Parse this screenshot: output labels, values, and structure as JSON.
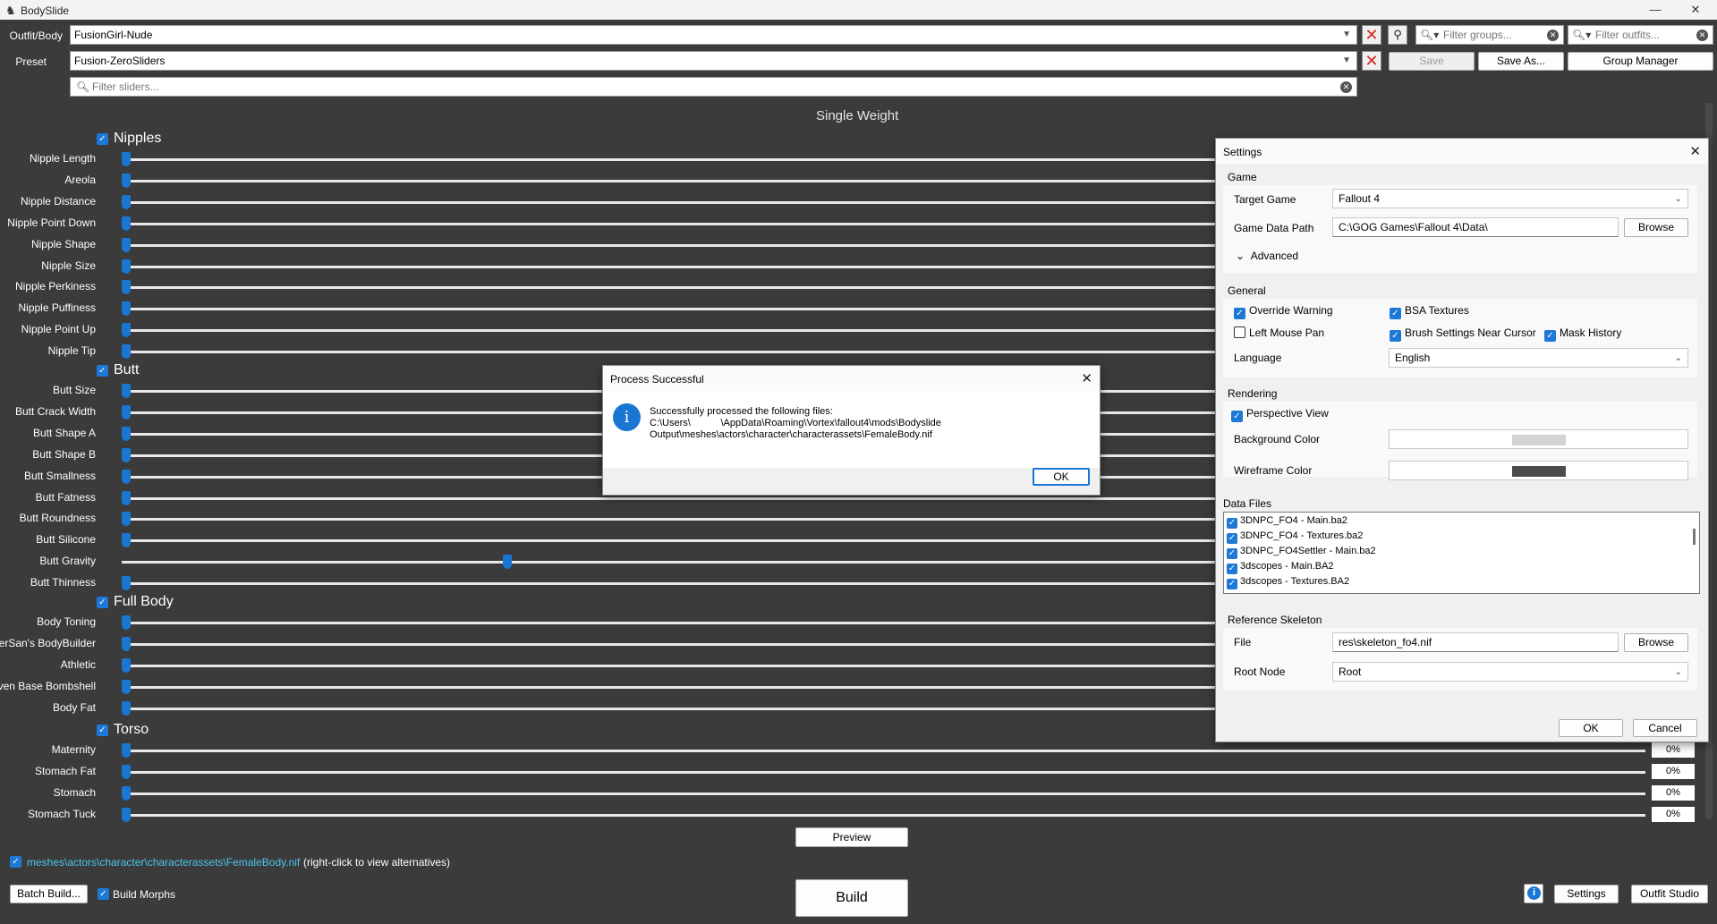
{
  "window": {
    "title": "BodySlide",
    "minimize": "—",
    "restore": "❐",
    "close": "✕"
  },
  "top": {
    "outfit_label": "Outfit/Body",
    "outfit_value": "FusionGirl-Nude",
    "preset_label": "Preset",
    "preset_value": "Fusion-ZeroSliders",
    "filter_groups_placeholder": "Filter groups...",
    "filter_outfits_placeholder": "Filter outfits...",
    "filter_sliders_placeholder": "Filter sliders...",
    "save_label": "Save",
    "save_as_label": "Save As...",
    "group_manager_label": "Group Manager"
  },
  "weight_mode": "Single Weight",
  "groups": [
    {
      "name": "Nipples",
      "sliders": [
        {
          "name": "Nipple Length",
          "value": 0
        },
        {
          "name": "Areola",
          "value": 0
        },
        {
          "name": "Nipple Distance",
          "value": 0
        },
        {
          "name": "Nipple Point Down",
          "value": 0
        },
        {
          "name": "Nipple Shape",
          "value": 0
        },
        {
          "name": "Nipple Size",
          "value": 0
        },
        {
          "name": "Nipple Perkiness",
          "value": 0
        },
        {
          "name": "Nipple Puffiness",
          "value": 0
        },
        {
          "name": "Nipple Point Up",
          "value": 0
        },
        {
          "name": "Nipple Tip",
          "value": 0
        }
      ]
    },
    {
      "name": "Butt",
      "sliders": [
        {
          "name": "Butt Size",
          "value": 0
        },
        {
          "name": "Butt Crack Width",
          "value": 0
        },
        {
          "name": "Butt Shape A",
          "value": 0
        },
        {
          "name": "Butt Shape B",
          "value": 0
        },
        {
          "name": "Butt Smallness",
          "value": 0
        },
        {
          "name": "Butt Fatness",
          "value": 0
        },
        {
          "name": "Butt Roundness",
          "value": 0
        },
        {
          "name": "Butt Silicone",
          "value": 0
        },
        {
          "name": "Butt Gravity",
          "value": 25
        },
        {
          "name": "Butt Thinness",
          "value": 0
        }
      ]
    },
    {
      "name": "Full Body",
      "sliders": [
        {
          "name": "Body Toning",
          "value": 0
        },
        {
          "name": "TigerSan's BodyBuilder",
          "value": 0
        },
        {
          "name": "Athletic",
          "value": 0
        },
        {
          "name": "Seven Base Bombshell",
          "value": 0
        },
        {
          "name": "Body Fat",
          "value": 0
        }
      ]
    },
    {
      "name": "Torso",
      "sliders": [
        {
          "name": "Maternity",
          "value": 0,
          "pct": "0%"
        },
        {
          "name": "Stomach Fat",
          "value": 0,
          "pct": "0%"
        },
        {
          "name": "Stomach",
          "value": 0,
          "pct": "0%"
        },
        {
          "name": "Stomach Tuck",
          "value": 0,
          "pct": "0%"
        }
      ]
    }
  ],
  "preview_label": "Preview",
  "build_label": "Build",
  "batch_build_label": "Batch Build...",
  "build_morphs_label": "Build Morphs",
  "output_path": "meshes\\actors\\character\\characterassets\\FemaleBody.nif",
  "output_hint": "(right-click to view alternatives)",
  "settings_button_label": "Settings",
  "outfit_studio_label": "Outfit Studio",
  "process_dialog": {
    "title": "Process Successful",
    "line1": "Successfully processed the following files:",
    "line2": "C:\\Users\\           \\AppData\\Roaming\\Vortex\\fallout4\\mods\\Bodyslide",
    "line3": "Output\\meshes\\actors\\character\\characterassets\\FemaleBody.nif",
    "ok": "OK"
  },
  "settings": {
    "title": "Settings",
    "game_section": "Game",
    "target_game_label": "Target Game",
    "target_game_value": "Fallout 4",
    "game_data_path_label": "Game Data Path",
    "game_data_path_value": "C:\\GOG Games\\Fallout 4\\Data\\",
    "browse": "Browse",
    "advanced": "Advanced",
    "general_section": "General",
    "override_warning": "Override Warning",
    "bsa_textures": "BSA Textures",
    "left_mouse_pan": "Left Mouse Pan",
    "brush_settings": "Brush Settings Near Cursor",
    "mask_history": "Mask History",
    "language_label": "Language",
    "language_value": "English",
    "rendering_section": "Rendering",
    "perspective_view": "Perspective View",
    "background_color_label": "Background Color",
    "background_color": "#d3d3d3",
    "wireframe_color_label": "Wireframe Color",
    "wireframe_color": "#4b4b4b",
    "data_files_section": "Data Files",
    "data_files": [
      "3DNPC_FO4 - Main.ba2",
      "3DNPC_FO4 - Textures.ba2",
      "3DNPC_FO4Settler - Main.ba2",
      "3dscopes - Main.BA2",
      "3dscopes - Textures.BA2"
    ],
    "ref_skeleton_section": "Reference Skeleton",
    "file_label": "File",
    "file_value": "res\\skeleton_fo4.nif",
    "root_node_label": "Root Node",
    "root_node_value": "Root",
    "ok": "OK",
    "cancel": "Cancel"
  },
  "colors": {
    "accent": "#1976d2",
    "background": "#3b3b3b",
    "link": "#4ac6ee",
    "clear_red": "#d12a1f"
  }
}
